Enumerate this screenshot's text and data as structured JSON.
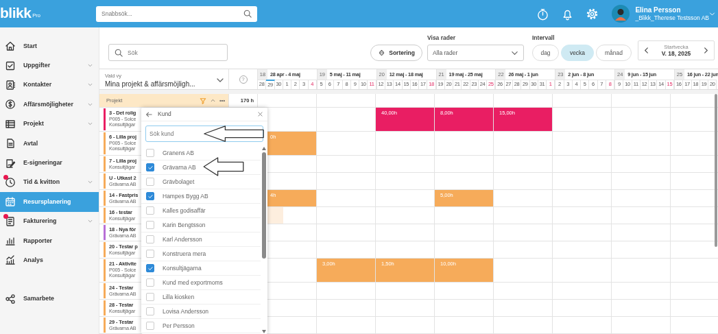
{
  "topbar": {
    "logo": "blikk",
    "logo_suffix": "Pro",
    "search": {
      "placeholder": "Snabbsök..."
    },
    "user": {
      "name": "Elina Persson",
      "company": "_Blikk_Therese Testsson AB"
    }
  },
  "sidebar": {
    "items": [
      {
        "label": "Start",
        "expandable": false,
        "notification": false,
        "selected": false
      },
      {
        "label": "Uppgifter",
        "expandable": true,
        "notification": false,
        "selected": false
      },
      {
        "label": "Kontakter",
        "expandable": true,
        "notification": false,
        "selected": false
      },
      {
        "label": "Affärsmöjligheter",
        "expandable": true,
        "notification": false,
        "selected": false
      },
      {
        "label": "Projekt",
        "expandable": true,
        "notification": false,
        "selected": false
      },
      {
        "label": "Avtal",
        "expandable": false,
        "notification": false,
        "selected": false
      },
      {
        "label": "E-signeringar",
        "expandable": false,
        "notification": false,
        "selected": false
      },
      {
        "label": "Tid & kvitton",
        "expandable": true,
        "notification": true,
        "selected": false
      },
      {
        "label": "Resursplanering",
        "expandable": false,
        "notification": false,
        "selected": true
      },
      {
        "label": "Fakturering",
        "expandable": true,
        "notification": true,
        "selected": false
      },
      {
        "label": "Rapporter",
        "expandable": false,
        "notification": false,
        "selected": false
      },
      {
        "label": "Analys",
        "expandable": false,
        "notification": false,
        "selected": false
      }
    ],
    "bottom_items": [
      {
        "label": "Samarbete",
        "expandable": false,
        "notification": false,
        "selected": false
      }
    ]
  },
  "toolbar": {
    "search": {
      "placeholder": "Sök"
    },
    "sort_button": "Sortering",
    "rows_filter": {
      "label": "Visa rader",
      "value": "Alla rader"
    },
    "interval": {
      "label": "Intervall",
      "options": [
        {
          "label": "dag",
          "selected": false
        },
        {
          "label": "vecka",
          "selected": true
        },
        {
          "label": "månad",
          "selected": false
        }
      ]
    },
    "start_week": {
      "label": "Startvecka",
      "value": "V. 18, 2025"
    }
  },
  "timeline": {
    "view": {
      "label": "Vald vy",
      "value": "Mina projekt & affärsmöjligh..."
    },
    "help": "?",
    "weeks": [
      {
        "number": "18",
        "range": "28 apr - 4 maj",
        "days": [
          {
            "label": "28",
            "today": false
          },
          {
            "label": "29",
            "today": true
          },
          {
            "label": "30",
            "today": false
          },
          {
            "label": "1",
            "today": false
          },
          {
            "label": "2",
            "today": false
          },
          {
            "label": "3",
            "today": false
          },
          {
            "label": "4",
            "today": false
          }
        ]
      },
      {
        "number": "19",
        "range": "5 maj - 11 maj",
        "days": [
          {
            "label": "5",
            "today": false
          },
          {
            "label": "6",
            "today": false
          },
          {
            "label": "7",
            "today": false
          },
          {
            "label": "8",
            "today": false
          },
          {
            "label": "9",
            "today": false
          },
          {
            "label": "10",
            "today": false
          },
          {
            "label": "11",
            "today": false
          }
        ]
      },
      {
        "number": "20",
        "range": "12 maj - 18 maj",
        "days": [
          {
            "label": "12",
            "today": false
          },
          {
            "label": "13",
            "today": false
          },
          {
            "label": "14",
            "today": false
          },
          {
            "label": "15",
            "today": false
          },
          {
            "label": "16",
            "today": false
          },
          {
            "label": "17",
            "today": false
          },
          {
            "label": "18",
            "today": false
          }
        ]
      },
      {
        "number": "21",
        "range": "19 maj - 25 maj",
        "days": [
          {
            "label": "19",
            "today": false
          },
          {
            "label": "20",
            "today": false
          },
          {
            "label": "21",
            "today": false
          },
          {
            "label": "22",
            "today": false
          },
          {
            "label": "23",
            "today": false
          },
          {
            "label": "24",
            "today": false
          },
          {
            "label": "25",
            "today": false
          }
        ]
      },
      {
        "number": "22",
        "range": "26 maj - 1 jun",
        "days": [
          {
            "label": "26",
            "today": false
          },
          {
            "label": "27",
            "today": false
          },
          {
            "label": "28",
            "today": false
          },
          {
            "label": "29",
            "today": false
          },
          {
            "label": "30",
            "today": false
          },
          {
            "label": "31",
            "today": false
          },
          {
            "label": "1",
            "today": false
          }
        ]
      },
      {
        "number": "23",
        "range": "2 jun - 8 jun",
        "days": [
          {
            "label": "2",
            "today": false
          },
          {
            "label": "3",
            "today": false
          },
          {
            "label": "4",
            "today": false
          },
          {
            "label": "5",
            "today": false
          },
          {
            "label": "6",
            "today": false
          },
          {
            "label": "7",
            "today": false
          },
          {
            "label": "8",
            "today": false
          }
        ]
      },
      {
        "number": "24",
        "range": "9 jun - 15 jun",
        "days": [
          {
            "label": "9",
            "today": false
          },
          {
            "label": "10",
            "today": false
          },
          {
            "label": "11",
            "today": false
          },
          {
            "label": "12",
            "today": false
          },
          {
            "label": "13",
            "today": false
          },
          {
            "label": "14",
            "today": false
          },
          {
            "label": "15",
            "today": false
          }
        ]
      },
      {
        "number": "25",
        "range": "16 jun - 22 jun",
        "days": [
          {
            "label": "16",
            "today": false
          },
          {
            "label": "17",
            "today": false
          },
          {
            "label": "18",
            "today": false
          },
          {
            "label": "19",
            "today": false
          },
          {
            "label": "20",
            "today": false
          }
        ]
      }
    ],
    "group": {
      "label": "Projekt",
      "total": "170 h"
    },
    "rows": [
      {
        "lines": [
          "3 - Det rolig",
          "P005 - Solce",
          "Konsultjägar"
        ],
        "color": "#e91e63",
        "cells": [
          {
            "kind": "empty"
          },
          {
            "kind": "empty"
          },
          {
            "kind": "booked",
            "label": "40,00h"
          },
          {
            "kind": "booked",
            "label": "8,00h"
          },
          {
            "kind": "booked",
            "label": "15,00h"
          }
        ]
      },
      {
        "lines": [
          "6 - Lilla proj",
          "P005 - Solce",
          "Konsultjägar"
        ],
        "color": "#f6ab5a",
        "cells": [
          {
            "kind": "booked",
            "label": "0h"
          }
        ]
      },
      {
        "lines": [
          "7 - Lilla proj",
          "Konsultjägar"
        ],
        "color": "#f6ab5a",
        "cells": []
      },
      {
        "lines": [
          "U - Utkast 2",
          "Grävarna AB"
        ],
        "color": "#f6ab5a",
        "cells": []
      },
      {
        "lines": [
          "14 - Fastpris",
          "Grävarna AB"
        ],
        "color": "#f6ab5a",
        "cells": [
          {
            "kind": "booked",
            "label": "4h"
          },
          {
            "kind": "empty"
          },
          {
            "kind": "empty"
          },
          {
            "kind": "booked",
            "label": "5,00h"
          }
        ]
      },
      {
        "lines": [
          "16 - testar",
          "Konsultjägar"
        ],
        "color": "#f6ab5a",
        "cells": [
          {
            "kind": "partial"
          }
        ]
      },
      {
        "lines": [
          "18 - Nya för",
          "Grävarna AB"
        ],
        "color": "#b86fd6",
        "cells": []
      },
      {
        "lines": [
          "20 - Testar p",
          "Konsultjägar"
        ],
        "color": "#f6ab5a",
        "cells": []
      },
      {
        "lines": [
          "21 - Aktivite",
          "P005 - Solce",
          "Konsultjägar"
        ],
        "color": "#f6ab5a",
        "cells": [
          {
            "kind": "empty"
          },
          {
            "kind": "booked",
            "label": "3,00h"
          },
          {
            "kind": "booked",
            "label": "1,50h"
          },
          {
            "kind": "booked",
            "label": "10,00h"
          }
        ]
      },
      {
        "lines": [
          "24 - Testar",
          "Grävarna AB"
        ],
        "color": "#f6ab5a",
        "cells": []
      },
      {
        "lines": [
          "28 - Testar",
          "Konsultjägar"
        ],
        "color": "#f6ab5a",
        "cells": []
      },
      {
        "lines": [
          "29 - Testar",
          "Grävarna AB"
        ],
        "color": "#f6ab5a",
        "cells": []
      }
    ]
  },
  "popover": {
    "title": "Kund",
    "search": {
      "placeholder": "Sök kund",
      "annotated": true
    },
    "items": [
      {
        "label": "Granens AB",
        "checked": false,
        "annotated": false
      },
      {
        "label": "Grävarna AB",
        "checked": true,
        "annotated": true
      },
      {
        "label": "Grävbolaget",
        "checked": false,
        "annotated": false
      },
      {
        "label": "Hampes Bygg AB",
        "checked": true,
        "annotated": false
      },
      {
        "label": "Kalles godisaffär",
        "checked": false,
        "annotated": false
      },
      {
        "label": "Karin Bengtsson",
        "checked": false,
        "annotated": false
      },
      {
        "label": "Karl Andersson",
        "checked": false,
        "annotated": false
      },
      {
        "label": "Konstruera mera",
        "checked": false,
        "annotated": false
      },
      {
        "label": "Konsultjägarna",
        "checked": true,
        "annotated": false
      },
      {
        "label": "Kund med exportmoms",
        "checked": false,
        "annotated": false
      },
      {
        "label": "Lilla kiosken",
        "checked": false,
        "annotated": false
      },
      {
        "label": "Lovisa Andersson",
        "checked": false,
        "annotated": false
      },
      {
        "label": "Per Persson",
        "checked": false,
        "annotated": false
      }
    ]
  }
}
